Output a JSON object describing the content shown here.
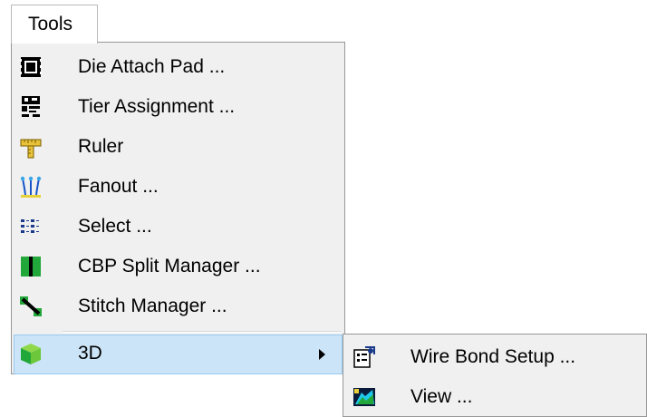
{
  "menubar": {
    "tools_label": "Tools"
  },
  "tools_menu": {
    "items": [
      {
        "label": "Die Attach Pad ...",
        "icon": "die-attach-pad-icon"
      },
      {
        "label": "Tier Assignment ...",
        "icon": "tier-assignment-icon"
      },
      {
        "label": "Ruler",
        "icon": "ruler-icon"
      },
      {
        "label": "Fanout ...",
        "icon": "fanout-icon"
      },
      {
        "label": "Select ...",
        "icon": "select-icon"
      },
      {
        "label": "CBP Split Manager ...",
        "icon": "cbp-split-manager-icon"
      },
      {
        "label": "Stitch Manager ...",
        "icon": "stitch-manager-icon"
      },
      {
        "label": "3D",
        "icon": "3d-cube-icon",
        "has_submenu": true,
        "highlighted": true
      }
    ]
  },
  "submenu_3d": {
    "items": [
      {
        "label": "Wire Bond Setup ...",
        "icon": "wire-bond-setup-icon"
      },
      {
        "label": "View ...",
        "icon": "3d-view-icon"
      }
    ]
  },
  "colors": {
    "menu_background": "#f0f0f0",
    "highlight_background": "#cce4f7",
    "highlight_border": "#99c9ef",
    "menu_border": "#979797"
  }
}
